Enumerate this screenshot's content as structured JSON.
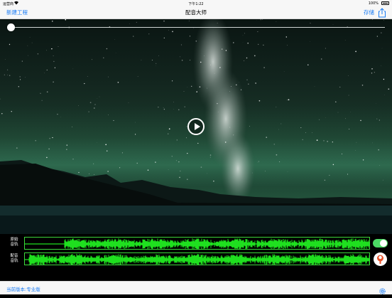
{
  "status_bar": {
    "carrier": "运营商",
    "time": "下午1:22",
    "battery": "100%"
  },
  "nav": {
    "new_project": "新建工程",
    "title": "配音大师",
    "save": "存储"
  },
  "player": {
    "progress": 0,
    "play_icon": "play-icon"
  },
  "tracks": [
    {
      "label_line1": "原始",
      "label_line2": "音轨",
      "enabled": true
    },
    {
      "label_line1": "配音",
      "label_line2": "音轨"
    }
  ],
  "footer": {
    "version_text": "当前版本:专业版"
  },
  "colors": {
    "accent": "#1a7cf5",
    "waveform": "#1fe01f",
    "toggle_on": "#4cd964"
  }
}
